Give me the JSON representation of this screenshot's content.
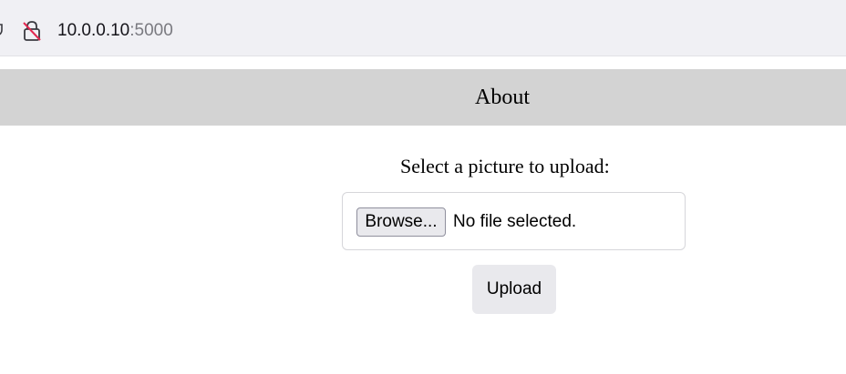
{
  "browser": {
    "url_host": "10.0.0.10",
    "url_port": ":5000",
    "icons": [
      "shield-icon",
      "insecure-lock-icon"
    ],
    "colors": {
      "toolbar_bg": "#f0f0f4",
      "insecure_slash": "#e22850"
    }
  },
  "nav": {
    "about_label": "About",
    "background": "#d3d3d3"
  },
  "upload_form": {
    "prompt": "Select a picture to upload:",
    "browse_label": "Browse...",
    "file_status": "No file selected.",
    "submit_label": "Upload"
  }
}
